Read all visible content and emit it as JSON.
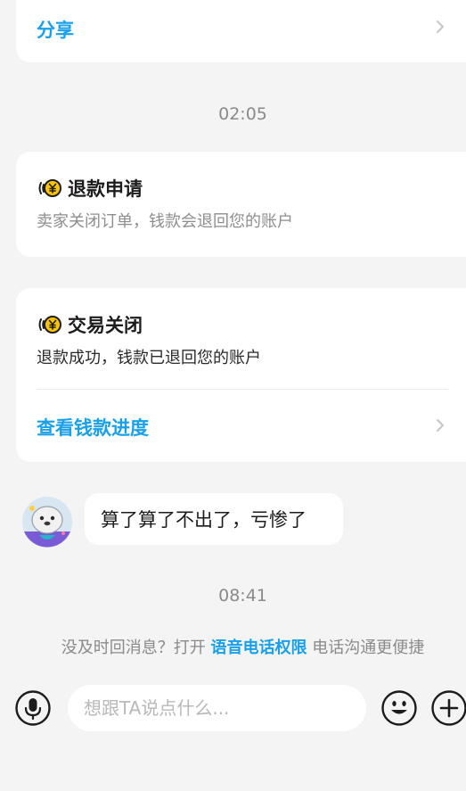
{
  "share_card": {
    "label": "分享"
  },
  "timestamps": {
    "first": "02:05",
    "second": "08:41"
  },
  "refund_card": {
    "title": "退款申请",
    "description": "卖家关闭订单，钱款会退回您的账户",
    "icon": "yuan-coin-icon"
  },
  "closed_card": {
    "title": "交易关闭",
    "description": "退款成功，钱款已退回您的账户",
    "link_label": "查看钱款进度",
    "icon": "yuan-coin-icon"
  },
  "message": {
    "text": "算了算了不出了，亏惨了"
  },
  "hint": {
    "prefix": "没及时回消息？打开 ",
    "highlight": "语音电话权限",
    "suffix": " 电话沟通更便捷"
  },
  "composer": {
    "placeholder": "想跟TA说点什么..."
  },
  "colors": {
    "accent": "#1aa0e8",
    "muted": "#8a8a8a",
    "background": "#f4f4f4"
  }
}
